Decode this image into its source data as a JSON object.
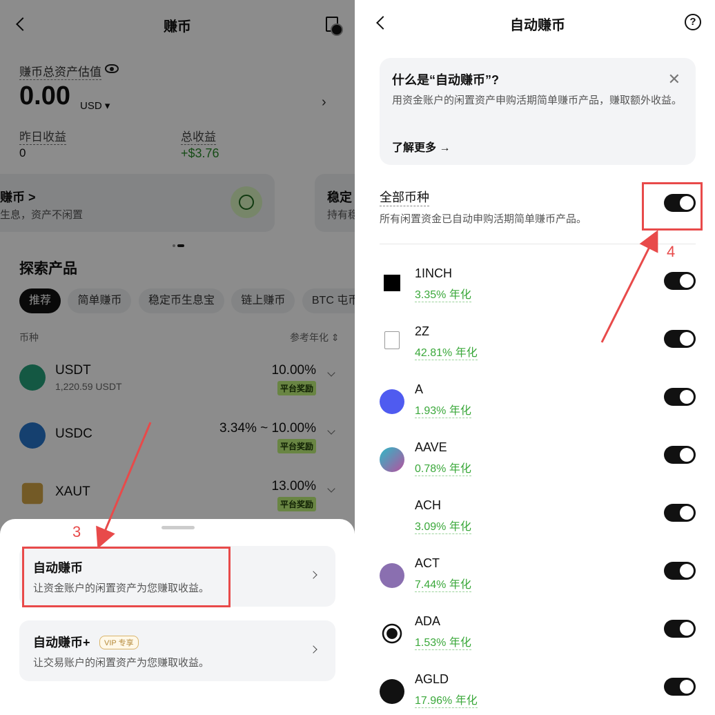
{
  "left": {
    "title": "赚币",
    "asset_label": "赚币总资产估值",
    "amount": "0.00",
    "currency": "USD ▾",
    "yesterday_label": "昨日收益",
    "yesterday_value": "0",
    "total_label": "总收益",
    "total_value": "+$3.76",
    "card1_title": "赚币 >",
    "card1_sub": "生息，资产不闲置",
    "card2_title": "稳定",
    "card2_sub": "持有稳",
    "explore_title": "探索产品",
    "chips": [
      "推荐",
      "简单赚币",
      "稳定币生息宝",
      "链上赚币",
      "BTC 屯币"
    ],
    "table_head_coin": "币种",
    "table_head_apr": "参考年化 ⇕",
    "rows": [
      {
        "name": "USDT",
        "sub": "1,220.59 USDT",
        "apr": "10.00%",
        "badge": "平台奖励"
      },
      {
        "name": "USDC",
        "sub": "",
        "apr": "3.34% ~ 10.00%",
        "badge": "平台奖励"
      },
      {
        "name": "XAUT",
        "sub": "",
        "apr": "13.00%",
        "badge": "平台奖励"
      }
    ],
    "sheet": {
      "item1_title": "自动赚币",
      "item1_desc": "让资金账户的闲置资产为您赚取收益。",
      "item2_title": "自动赚币+",
      "item2_vip": "VIP 专享",
      "item2_desc": "让交易账户的闲置资产为您赚取收益。"
    },
    "annotation": "3"
  },
  "right": {
    "title": "自动赚币",
    "info_title": "什么是“自动赚币”?",
    "info_close": "✕",
    "info_text": "用资金账户的闲置资产申购活期简单赚币产品，赚取额外收益。",
    "info_more": "了解更多 →",
    "all_title": "全部币种",
    "all_sub": "所有闲置资金已自动申购活期简单赚币产品。",
    "annotation": "4",
    "coins": [
      {
        "name": "1INCH",
        "apy": "3.35% 年化"
      },
      {
        "name": "2Z",
        "apy": "42.81% 年化"
      },
      {
        "name": "A",
        "apy": "1.93% 年化"
      },
      {
        "name": "AAVE",
        "apy": "0.78% 年化"
      },
      {
        "name": "ACH",
        "apy": "3.09% 年化"
      },
      {
        "name": "ACT",
        "apy": "7.44% 年化"
      },
      {
        "name": "ADA",
        "apy": "1.53% 年化"
      },
      {
        "name": "AGLD",
        "apy": "17.96% 年化"
      }
    ]
  },
  "colors": {
    "accent_red": "#e84a4a",
    "green": "#3aa83a",
    "badge": "#bff27a"
  }
}
